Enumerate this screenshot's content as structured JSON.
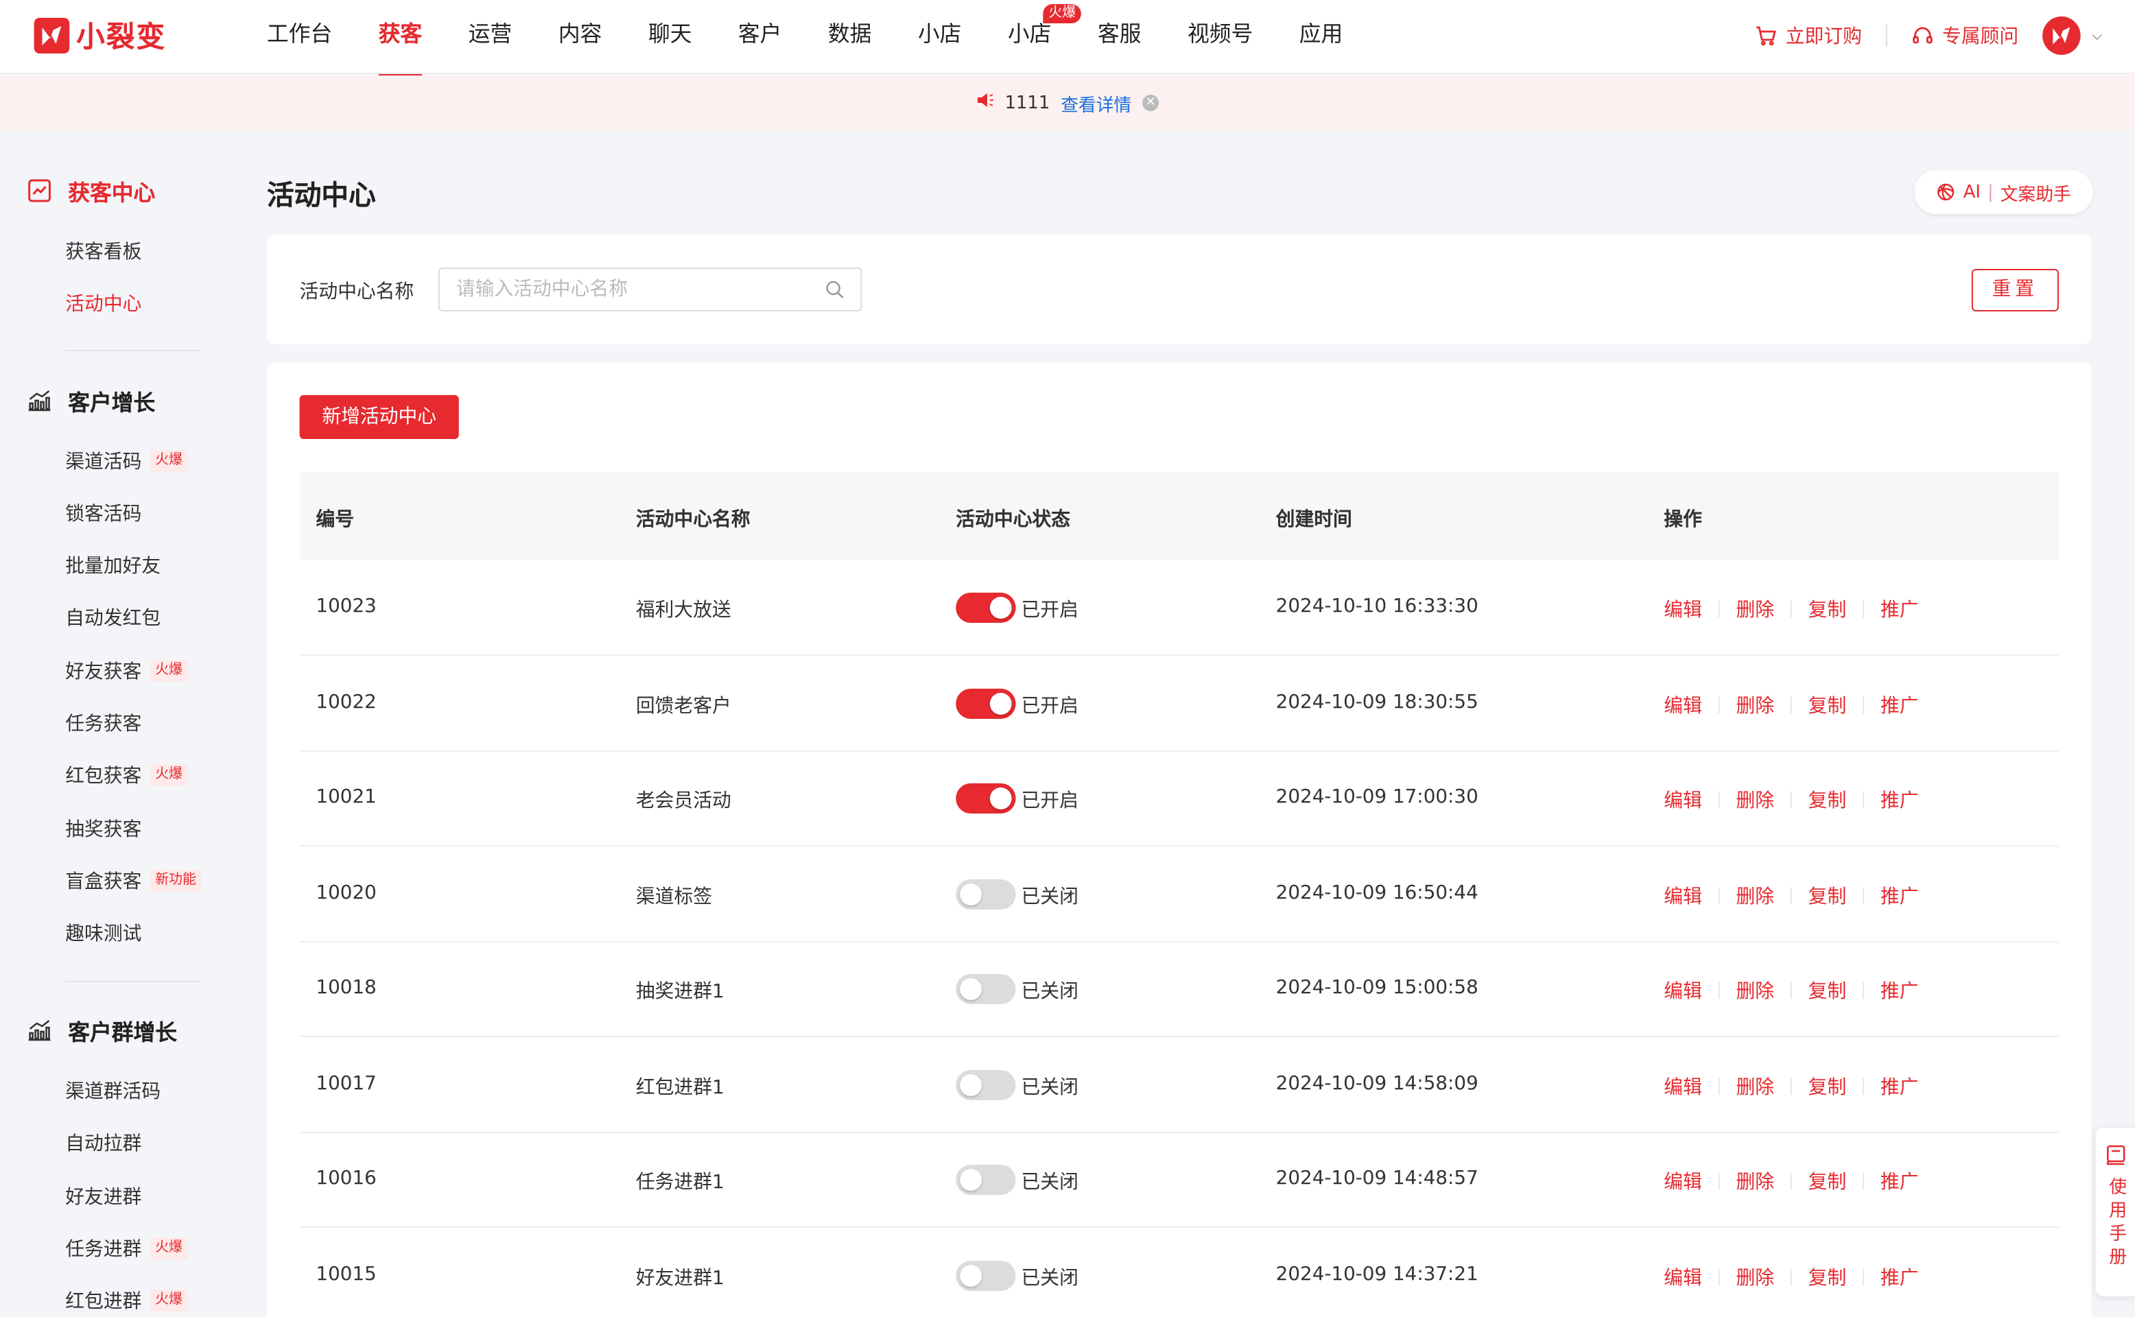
{
  "app": {
    "logo_text": "小裂变"
  },
  "nav": {
    "items": [
      {
        "label": "工作台",
        "active": false
      },
      {
        "label": "获客",
        "active": true
      },
      {
        "label": "运营",
        "active": false
      },
      {
        "label": "内容",
        "active": false
      },
      {
        "label": "聊天",
        "active": false
      },
      {
        "label": "客户",
        "active": false
      },
      {
        "label": "数据",
        "active": false
      },
      {
        "label": "小店",
        "active": false
      },
      {
        "label": "小店",
        "active": false,
        "badge": "火爆"
      },
      {
        "label": "客服",
        "active": false
      },
      {
        "label": "视频号",
        "active": false
      },
      {
        "label": "应用",
        "active": false
      }
    ],
    "order_label": "立即订购",
    "advisor_label": "专属顾问"
  },
  "notice": {
    "text": "1111",
    "link": "查看详情"
  },
  "sidebar": {
    "groups": [
      {
        "title": "获客中心",
        "active": true,
        "items": [
          {
            "label": "获客看板",
            "active": false
          },
          {
            "label": "活动中心",
            "active": true
          }
        ]
      },
      {
        "title": "客户增长",
        "active": false,
        "items": [
          {
            "label": "渠道活码",
            "tag": "火爆"
          },
          {
            "label": "锁客活码"
          },
          {
            "label": "批量加好友"
          },
          {
            "label": "自动发红包"
          },
          {
            "label": "好友获客",
            "tag": "火爆"
          },
          {
            "label": "任务获客"
          },
          {
            "label": "红包获客",
            "tag": "火爆"
          },
          {
            "label": "抽奖获客"
          },
          {
            "label": "盲盒获客",
            "tag": "新功能"
          },
          {
            "label": "趣味测试"
          }
        ]
      },
      {
        "title": "客户群增长",
        "active": false,
        "items": [
          {
            "label": "渠道群活码"
          },
          {
            "label": "自动拉群"
          },
          {
            "label": "好友进群"
          },
          {
            "label": "任务进群",
            "tag": "火爆"
          },
          {
            "label": "红包进群",
            "tag": "火爆"
          }
        ]
      }
    ]
  },
  "main": {
    "title": "活动中心",
    "ai_label": "AI",
    "ai_sep": "|",
    "ai_text": "文案助手",
    "filter": {
      "label": "活动中心名称",
      "placeholder": "请输入活动中心名称",
      "value": "",
      "reset_label": "重置"
    },
    "add_label": "新增活动中心",
    "table": {
      "headers": [
        "编号",
        "活动中心名称",
        "活动中心状态",
        "创建时间",
        "操作"
      ],
      "actions": [
        "编辑",
        "删除",
        "复制",
        "推广"
      ],
      "rows": [
        {
          "id": "10023",
          "name": "福利大放送",
          "enabled": true,
          "status": "已开启",
          "created": "2024-10-10 16:33:30"
        },
        {
          "id": "10022",
          "name": "回馈老客户",
          "enabled": true,
          "status": "已开启",
          "created": "2024-10-09 18:30:55"
        },
        {
          "id": "10021",
          "name": "老会员活动",
          "enabled": true,
          "status": "已开启",
          "created": "2024-10-09 17:00:30"
        },
        {
          "id": "10020",
          "name": "渠道标签",
          "enabled": false,
          "status": "已关闭",
          "created": "2024-10-09 16:50:44"
        },
        {
          "id": "10018",
          "name": "抽奖进群1",
          "enabled": false,
          "status": "已关闭",
          "created": "2024-10-09 15:00:58"
        },
        {
          "id": "10017",
          "name": "红包进群1",
          "enabled": false,
          "status": "已关闭",
          "created": "2024-10-09 14:58:09"
        },
        {
          "id": "10016",
          "name": "任务进群1",
          "enabled": false,
          "status": "已关闭",
          "created": "2024-10-09 14:48:57"
        },
        {
          "id": "10015",
          "name": "好友进群1",
          "enabled": false,
          "status": "已关闭",
          "created": "2024-10-09 14:37:21"
        }
      ]
    }
  },
  "manual": {
    "label": "使用手册"
  },
  "colors": {
    "accent": "#e62a2f",
    "link": "#1a6fe0",
    "background": "#f4f5f8"
  }
}
